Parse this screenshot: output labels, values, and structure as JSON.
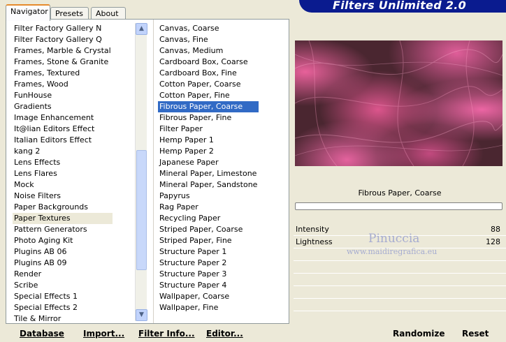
{
  "title": "Filters Unlimited 2.0",
  "tabs": [
    {
      "label": "Navigator",
      "active": true
    },
    {
      "label": "Presets",
      "active": false
    },
    {
      "label": "About",
      "active": false
    }
  ],
  "categories": {
    "items": [
      "Filter Factory Gallery N",
      "Filter Factory Gallery Q",
      "Frames, Marble & Crystal",
      "Frames, Stone & Granite",
      "Frames, Textured",
      "Frames, Wood",
      "FunHouse",
      "Gradients",
      "Image Enhancement",
      "It@lian Editors Effect",
      "Italian Editors Effect",
      "kang 2",
      "Lens Effects",
      "Lens Flares",
      "Mock",
      "Noise Filters",
      "Paper Backgrounds",
      "Paper Textures",
      "Pattern Generators",
      "Photo Aging Kit",
      "Plugins AB 06",
      "Plugins AB 09",
      "Render",
      "Scribe",
      "Special Effects 1",
      "Special Effects 2",
      "Tile & Mirror"
    ],
    "highlighted": "Paper Textures"
  },
  "filters": {
    "items": [
      "Canvas, Coarse",
      "Canvas, Fine",
      "Canvas, Medium",
      "Cardboard Box, Coarse",
      "Cardboard Box, Fine",
      "Cotton Paper, Coarse",
      "Cotton Paper, Fine",
      "Fibrous Paper, Coarse",
      "Fibrous Paper, Fine",
      "Filter Paper",
      "Hemp Paper 1",
      "Hemp Paper 2",
      "Japanese Paper",
      "Mineral Paper, Limestone",
      "Mineral Paper, Sandstone",
      "Papyrus",
      "Rag Paper",
      "Recycling Paper",
      "Striped Paper, Coarse",
      "Striped Paper, Fine",
      "Structure Paper 1",
      "Structure Paper 2",
      "Structure Paper 3",
      "Structure Paper 4",
      "Wallpaper, Coarse",
      "Wallpaper, Fine"
    ],
    "selected": "Fibrous Paper, Coarse"
  },
  "preview": {
    "caption": "Fibrous Paper, Coarse",
    "progress": 0
  },
  "sliders": [
    {
      "label": "Intensity",
      "value": "88"
    },
    {
      "label": "Lightness",
      "value": "128"
    }
  ],
  "watermark": {
    "name": "Pinuccia",
    "site": "www.maidiregrafica.eu"
  },
  "buttons": {
    "database": "Database",
    "import": "Import...",
    "filter_info": "Filter Info...",
    "editor": "Editor...",
    "randomize": "Randomize",
    "reset": "Reset"
  },
  "colors": {
    "selection": "#316ac5",
    "banner": "#0a1b8f",
    "preview_pink": "#f064a0",
    "preview_dark": "#4a2630"
  },
  "icons": {
    "scroll_up": "chevron-up-icon",
    "scroll_down": "chevron-down-icon"
  }
}
